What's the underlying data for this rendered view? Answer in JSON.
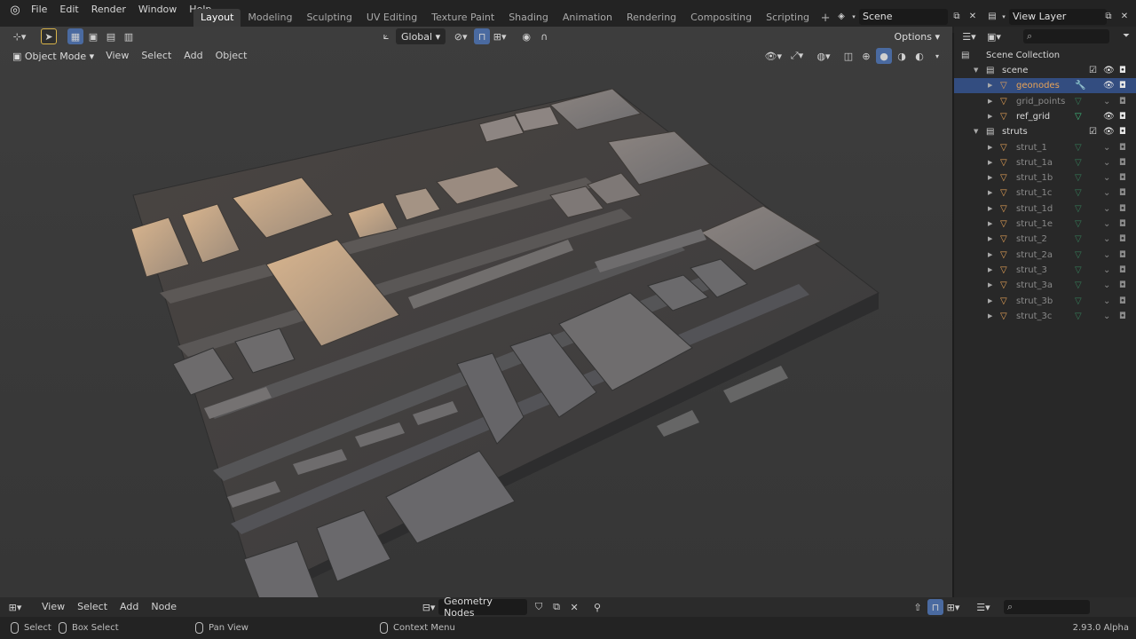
{
  "menubar": {
    "items": [
      "File",
      "Edit",
      "Render",
      "Window",
      "Help"
    ]
  },
  "workspaces": {
    "tabs": [
      "Layout",
      "Modeling",
      "Sculpting",
      "UV Editing",
      "Texture Paint",
      "Shading",
      "Animation",
      "Rendering",
      "Compositing",
      "Scripting"
    ],
    "active": "Layout"
  },
  "scene": {
    "name": "Scene"
  },
  "view_layer": {
    "name": "View Layer"
  },
  "viewport": {
    "transform_orientation": "Global",
    "options_label": "Options",
    "mode": "Object Mode",
    "menus": [
      "View",
      "Select",
      "Add",
      "Object"
    ]
  },
  "outliner": {
    "root": "Scene Collection",
    "rows": [
      {
        "label": "scene",
        "kind": "collection"
      },
      {
        "label": "geonodes",
        "kind": "object",
        "selected": true
      },
      {
        "label": "grid_points",
        "kind": "object",
        "dim": true
      },
      {
        "label": "ref_grid",
        "kind": "object"
      },
      {
        "label": "struts",
        "kind": "collection"
      },
      {
        "label": "strut_1",
        "kind": "object",
        "dim": true
      },
      {
        "label": "strut_1a",
        "kind": "object",
        "dim": true
      },
      {
        "label": "strut_1b",
        "kind": "object",
        "dim": true
      },
      {
        "label": "strut_1c",
        "kind": "object",
        "dim": true
      },
      {
        "label": "strut_1d",
        "kind": "object",
        "dim": true
      },
      {
        "label": "strut_1e",
        "kind": "object",
        "dim": true
      },
      {
        "label": "strut_2",
        "kind": "object",
        "dim": true
      },
      {
        "label": "strut_2a",
        "kind": "object",
        "dim": true
      },
      {
        "label": "strut_3",
        "kind": "object",
        "dim": true
      },
      {
        "label": "strut_3a",
        "kind": "object",
        "dim": true
      },
      {
        "label": "strut_3b",
        "kind": "object",
        "dim": true
      },
      {
        "label": "strut_3c",
        "kind": "object",
        "dim": true
      }
    ]
  },
  "node_editor": {
    "menus": [
      "View",
      "Select",
      "Add",
      "Node"
    ],
    "tree_name": "Geometry Nodes"
  },
  "statusbar": {
    "select": "Select",
    "box_select": "Box Select",
    "pan_view": "Pan View",
    "context_menu": "Context Menu",
    "version": "2.93.0 Alpha"
  },
  "colors": {
    "accent_blue": "#4a6aa0",
    "selection": "#334d80",
    "object_orange": "#e8a357",
    "mesh_green": "#3fbf7f"
  }
}
